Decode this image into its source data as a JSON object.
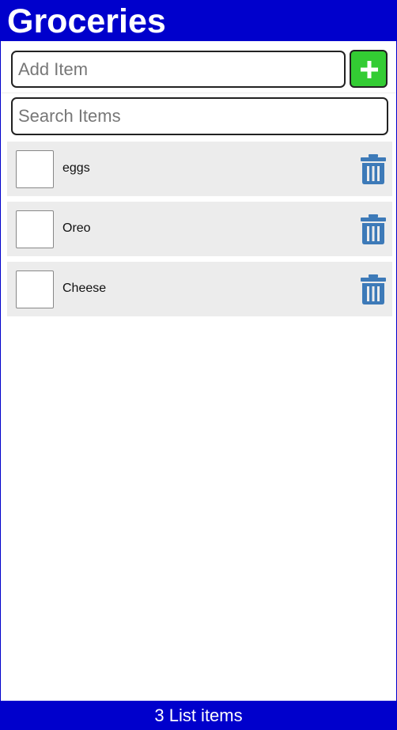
{
  "header": {
    "title": "Groceries"
  },
  "add_item": {
    "placeholder": "Add Item",
    "value": "",
    "button_icon": "plus-icon"
  },
  "search": {
    "placeholder": "Search Items",
    "value": ""
  },
  "items": [
    {
      "label": "eggs",
      "checked": false,
      "delete_icon": "trash-icon"
    },
    {
      "label": "Oreo",
      "checked": false,
      "delete_icon": "trash-icon"
    },
    {
      "label": "Cheese",
      "checked": false,
      "delete_icon": "trash-icon"
    }
  ],
  "footer": {
    "count_text": "3 List items"
  },
  "colors": {
    "brand": "#0000cc",
    "add_button": "#33cc33",
    "trash_icon": "#3d7ab8",
    "row_background": "#ececec"
  }
}
